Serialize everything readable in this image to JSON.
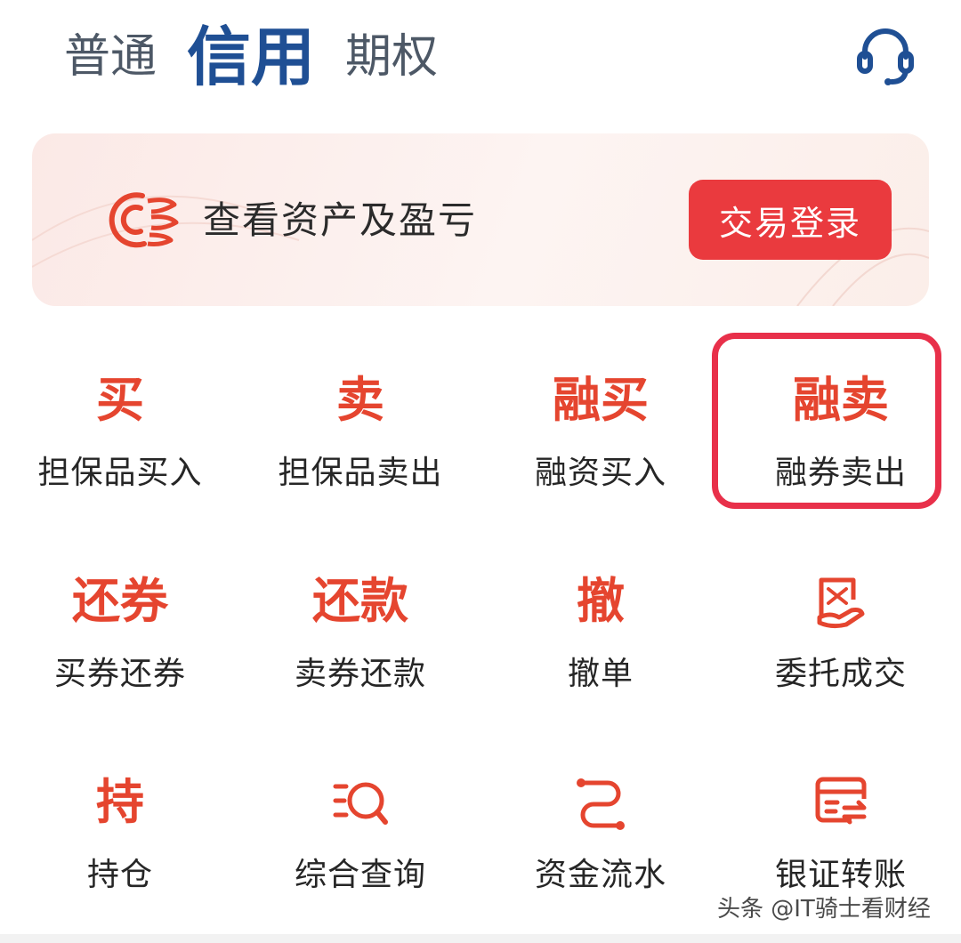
{
  "tabs": [
    {
      "label": "普通",
      "active": false
    },
    {
      "label": "信用",
      "active": true
    },
    {
      "label": "期权",
      "active": false
    }
  ],
  "header": {
    "support_icon": "headset-icon"
  },
  "banner": {
    "logo_icon": "brand-logo-icon",
    "text": "查看资产及盈亏",
    "login_label": "交易登录"
  },
  "grid": [
    {
      "glyph": "买",
      "label": "担保品买入"
    },
    {
      "glyph": "卖",
      "label": "担保品卖出"
    },
    {
      "glyph": "融买",
      "label": "融资买入"
    },
    {
      "glyph": "融卖",
      "label": "融券卖出",
      "highlighted": true
    },
    {
      "glyph": "还券",
      "label": "买券还券"
    },
    {
      "glyph": "还款",
      "label": "卖券还款"
    },
    {
      "glyph": "撤",
      "label": "撤单"
    },
    {
      "icon": "order-record-icon",
      "label": "委托成交"
    },
    {
      "glyph": "持",
      "label": "持仓"
    },
    {
      "icon": "search-list-icon",
      "label": "综合查询"
    },
    {
      "icon": "fund-flow-icon",
      "label": "资金流水"
    },
    {
      "icon": "bank-transfer-icon",
      "label": "银证转账"
    }
  ],
  "watermark": "头条 @IT骑士看财经",
  "colors": {
    "accent": "#e5452f",
    "tab_active": "#1f4f94",
    "login_button": "#ea3a3e",
    "highlight": "#e8304a"
  }
}
